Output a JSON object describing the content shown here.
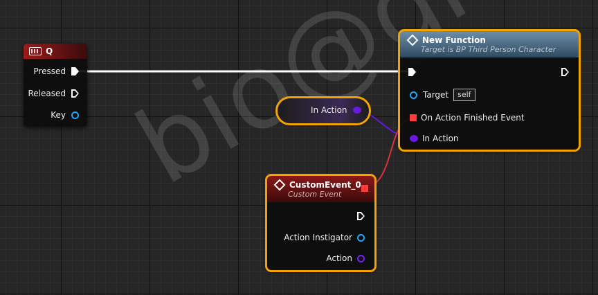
{
  "watermark": "bio@gma",
  "key_node": {
    "title": "Q",
    "pins": {
      "pressed": "Pressed",
      "released": "Released",
      "key": "Key"
    }
  },
  "function_node": {
    "title": "New Function",
    "subtitle": "Target is BP Third Person Character",
    "pins": {
      "target": "Target",
      "target_value": "self",
      "on_action_finished": "On Action Finished Event",
      "in_action": "In Action"
    }
  },
  "variable_node": {
    "label": "In Action"
  },
  "custom_event_node": {
    "title": "CustomEvent_0",
    "subtitle": "Custom Event",
    "pins": {
      "action_instigator": "Action Instigator",
      "action": "Action"
    }
  },
  "colors": {
    "selection": "#f3a300",
    "exec_wire": "#ffffff",
    "object_pin": "#1ea7ff",
    "event_pin": "#ff3b3b",
    "interface_pin": "#7a1cff",
    "event_wire": "#d8333b"
  }
}
